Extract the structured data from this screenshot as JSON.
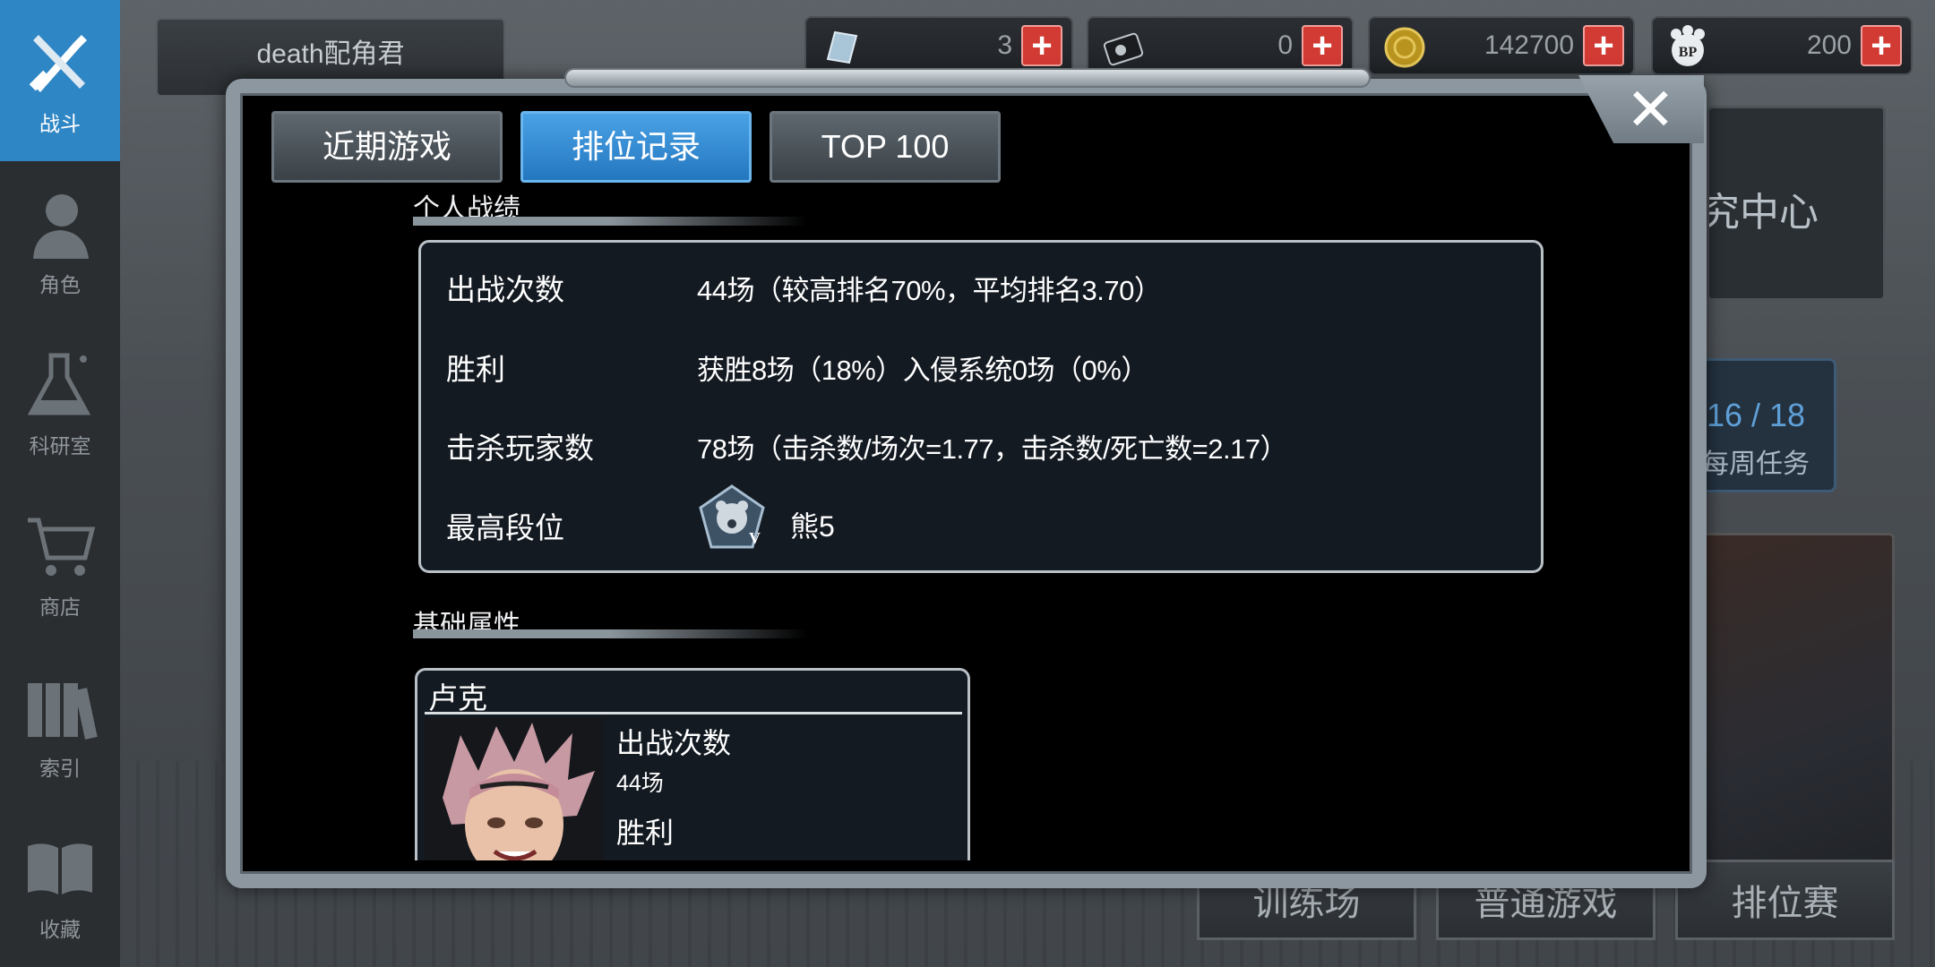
{
  "sidebar": {
    "items": [
      {
        "label": "战斗",
        "icon": "crossed-weapons-icon",
        "active": true
      },
      {
        "label": "角色",
        "icon": "character-bust-icon",
        "active": false
      },
      {
        "label": "科研室",
        "icon": "flask-icon",
        "active": false
      },
      {
        "label": "商店",
        "icon": "shopping-cart-icon",
        "active": false
      },
      {
        "label": "索引",
        "icon": "books-icon",
        "active": false
      },
      {
        "label": "收藏",
        "icon": "open-book-icon",
        "active": false
      }
    ]
  },
  "topbar": {
    "player_name": "death配角君",
    "resources": [
      {
        "icon": "crystal-icon",
        "value": "3"
      },
      {
        "icon": "disk-icon",
        "value": "0"
      },
      {
        "icon": "gold-coin-icon",
        "value": "142700"
      },
      {
        "icon": "bp-paw-icon",
        "value": "200"
      }
    ]
  },
  "background": {
    "research_center": "究中心",
    "weekly_tasks": {
      "value": "16 / 18",
      "label": "每周任务"
    },
    "bottom_buttons": [
      "训练场",
      "普通游戏",
      "排位赛"
    ]
  },
  "modal": {
    "close_label": "✕",
    "tabs": [
      {
        "label": "近期游戏",
        "active": false
      },
      {
        "label": "排位记录",
        "active": true
      },
      {
        "label": "TOP 100",
        "active": false
      }
    ],
    "personal": {
      "title": "个人战绩",
      "rows": [
        {
          "label": "出战次数",
          "value": "44场（较高排名70%，平均排名3.70）"
        },
        {
          "label": "胜利",
          "value": "获胜8场（18%）入侵系统0场（0%）"
        },
        {
          "label": "击杀玩家数",
          "value": "78场（击杀数/场次=1.77，击杀数/死亡数=2.17）"
        },
        {
          "label": "最高段位",
          "value": "熊5"
        }
      ],
      "rank_badge_letter": "V"
    },
    "basic": {
      "title": "基础属性",
      "character": {
        "name": "卢克",
        "stats": [
          {
            "label": "出战次数",
            "value": "44场"
          },
          {
            "label": "胜利",
            "value": ""
          }
        ]
      }
    }
  }
}
